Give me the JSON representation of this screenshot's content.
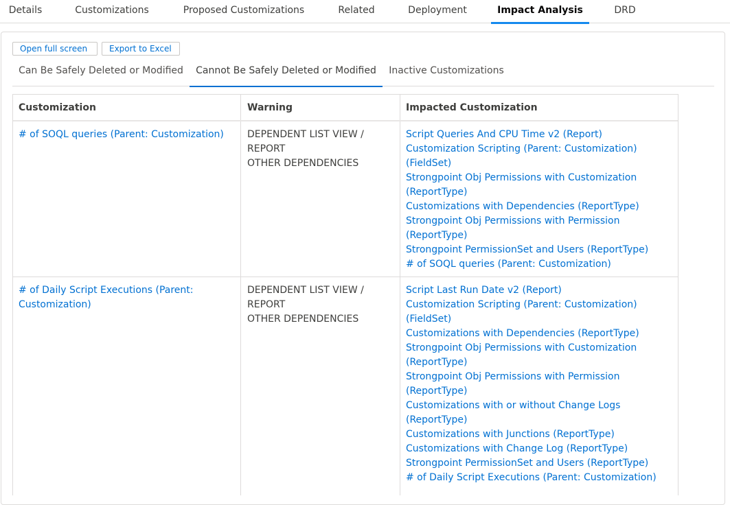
{
  "top_tabs": [
    {
      "label": "Details"
    },
    {
      "label": "Customizations"
    },
    {
      "label": "Proposed Customizations"
    },
    {
      "label": "Related"
    },
    {
      "label": "Deployment"
    },
    {
      "label": "Impact Analysis"
    },
    {
      "label": "DRD"
    }
  ],
  "toolbar": {
    "open_full_screen": "Open full screen",
    "export_to_excel": "Export to Excel"
  },
  "sub_tabs": [
    {
      "label": "Can Be Safely Deleted or Modified"
    },
    {
      "label": "Cannot Be Safely Deleted or Modified"
    },
    {
      "label": "Inactive Customizations"
    }
  ],
  "table": {
    "headers": {
      "customization": "Customization",
      "warning": "Warning",
      "impacted": "Impacted Customization"
    },
    "rows": [
      {
        "customization": [
          "# of SOQL queries (Parent: Customization)"
        ],
        "warning": [
          "DEPENDENT LIST VIEW /",
          "REPORT",
          "OTHER DEPENDENCIES"
        ],
        "impacted": [
          "Script Queries And CPU Time v2 (Report)",
          "Customization Scripting (Parent: Customization)",
          "(FieldSet)",
          "Strongpoint Obj Permissions with Customization",
          "(ReportType)",
          "Customizations with Dependencies (ReportType)",
          "Strongpoint Obj Permissions with Permission",
          "(ReportType)",
          "Strongpoint PermissionSet and Users (ReportType)",
          "# of SOQL queries (Parent: Customization)"
        ]
      },
      {
        "customization": [
          "# of Daily Script Executions (Parent:",
          "Customization)"
        ],
        "warning": [
          "DEPENDENT LIST VIEW /",
          "REPORT",
          "OTHER DEPENDENCIES"
        ],
        "impacted": [
          "Script Last Run Date v2 (Report)",
          "Customization Scripting (Parent: Customization)",
          "(FieldSet)",
          "Customizations with Dependencies (ReportType)",
          "Strongpoint Obj Permissions with Customization",
          "(ReportType)",
          "Strongpoint Obj Permissions with Permission",
          "(ReportType)",
          "Customizations with or without Change Logs",
          "(ReportType)",
          "Customizations with Junctions (ReportType)",
          "Customizations with Change Log (ReportType)",
          "Strongpoint PermissionSet and Users (ReportType)",
          "# of Daily Script Executions (Parent: Customization)"
        ]
      }
    ]
  }
}
